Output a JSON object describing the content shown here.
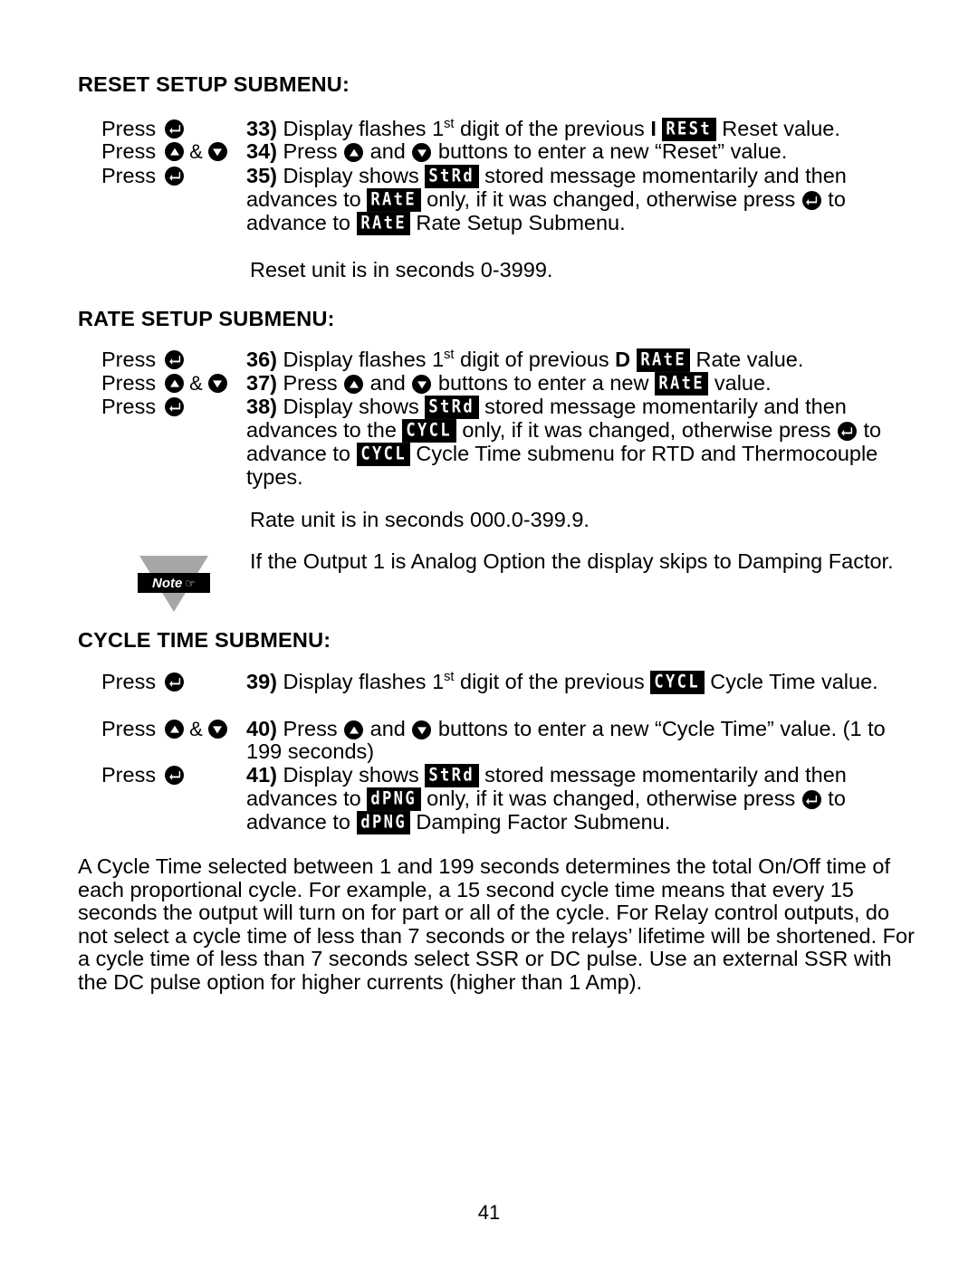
{
  "page": {
    "number": "41"
  },
  "sections": [
    {
      "id": "reset",
      "heading": "RESET SETUP SUBMENU:",
      "steps": [
        {
          "press_label": "Press",
          "buttons": [
            "enter-button"
          ],
          "number": "33)",
          "lines": [
            "Display flashes 1st digit of the previous I",
            "Reset value."
          ],
          "badges": [
            "RESt"
          ]
        },
        {
          "press_label": "Press",
          "buttons": [
            "up-button",
            "down-button"
          ],
          "number": "34)",
          "lines": [
            "Press",
            "and",
            "buttons to enter a new “Reset” value."
          ]
        },
        {
          "press_label": "Press",
          "buttons": [
            "enter-button"
          ],
          "number": "35)",
          "lines": [
            "Display shows",
            "stored message momentarily and then advances to",
            "only, if it was changed, otherwise press",
            "to advance to",
            "Rate Setup Submenu."
          ],
          "badges": [
            "StRd",
            "RAtE",
            "RAtE"
          ]
        }
      ],
      "note_line": "Reset unit is in seconds 0-3999."
    },
    {
      "id": "rate",
      "heading": "RATE SETUP SUBMENU:",
      "steps": [
        {
          "press_label": "Press",
          "buttons": [
            "enter-button"
          ],
          "number": "36)",
          "lines": [
            "Display flashes 1st digit of previous D",
            "Rate value."
          ],
          "badges": [
            "RAtE"
          ]
        },
        {
          "press_label": "Press",
          "buttons": [
            "up-button",
            "down-button"
          ],
          "number": "37)",
          "lines": [
            "Press",
            "and",
            "buttons to enter a new",
            "value."
          ],
          "badges": [
            "RAtE"
          ]
        },
        {
          "press_label": "Press",
          "buttons": [
            "enter-button"
          ],
          "number": "38)",
          "lines": [
            "Display shows",
            "stored message momentarily and then advances to the",
            "only, if it was changed, otherwise press",
            "to advance to",
            "Cycle Time submenu for RTD and Thermocouple types."
          ],
          "badges": [
            "StRd",
            "CYCL",
            "CYCL"
          ]
        }
      ],
      "note_line": "Rate unit is in seconds 000.0-399.9."
    },
    {
      "id": "cycle-time",
      "heading": "CYCLE TIME SUBMENU:",
      "steps": [
        {
          "press_label": "Press",
          "buttons": [
            "enter-button"
          ],
          "number": "39)",
          "lines": [
            "Display flashes 1st digit of the previous",
            "Cycle Time value."
          ],
          "badges": [
            "CYCL"
          ]
        },
        {
          "press_label": "Press",
          "buttons": [
            "up-button",
            "down-button"
          ],
          "number": "40)",
          "lines": [
            "Press",
            "and",
            "buttons to enter a new “Cycle Time” value.",
            "(1 to 199 seconds)"
          ]
        },
        {
          "press_label": "Press",
          "buttons": [
            "enter-button"
          ],
          "number": "41)",
          "lines": [
            "Display shows",
            "stored message momentarily and then advances to",
            "only, if it was changed, otherwise press",
            "to advance to",
            "Damping Factor Submenu."
          ],
          "badges": [
            "StRd",
            "dPNG",
            "dPNG"
          ]
        }
      ]
    }
  ],
  "note_box": {
    "tag_label": "Note",
    "tag_icon": "pointing-hand-icon",
    "text": "If the Output 1 is Analog Option the display skips to Damping Factor."
  },
  "closing_paragraph": "A Cycle Time selected between 1 and 199 seconds determines the total On/Off time of each proportional cycle. For example, a 15 second cycle time means that every 15 seconds the output will turn on for part or all of the cycle. For Relay control outputs, do not select a cycle time of less than 7 seconds or the relays’ lifetime will be shortened. For a cycle time of less than 7 seconds select SSR or DC pulse. Use an external SSR with the DC pulse option for higher currents (higher than 1 Amp).",
  "text_fragments": {
    "display_flashes": "Display flashes 1",
    "st": "st",
    "digit_of_the_previous": " digit of the previous ",
    "digit_of_previous": " digit of previous ",
    "press": "Press ",
    "and": " and ",
    "buttons_reset": " buttons to enter a new “Reset” value.",
    "buttons_rate_pre": " buttons to enter a new ",
    "buttons_rate_post": " value.",
    "buttons_cycle": " buttons to enter a new “Cycle Time” value.",
    "cycle_range": "(1 to 199 seconds)",
    "display_shows": "Display shows ",
    "stored_then_advances": " stored message momentarily and then",
    "advances_to": "advances to ",
    "advances_to_the": "advances to the ",
    "only_if_changed": " only, if it was changed, otherwise press ",
    "to_word": " to",
    "advance_to": "advance to ",
    "to_advance_to": "to advance to ",
    "rate_setup_submenu": " Rate Setup Submenu.",
    "cycle_submenu_rtd": " Cycle Time submenu for RTD and",
    "thermocouple_types": "Thermocouple types.",
    "damping_submenu": " Damping Factor Submenu.",
    "reset_value": " Reset value.",
    "rate_value": " Rate value.",
    "cycle_time_label": " Cycle Time",
    "value_word": "value.",
    "bold_i": "I",
    "bold_d": "D"
  },
  "icons": {
    "enter": "enter-button-icon",
    "up": "up-arrow-button-icon",
    "down": "down-arrow-button-icon",
    "hand": "☞"
  },
  "colors": {
    "text": "#000000",
    "background": "#ffffff",
    "lcd_background": "#000000",
    "lcd_text": "#ffffff",
    "note_triangle": "#a6a6a6"
  }
}
